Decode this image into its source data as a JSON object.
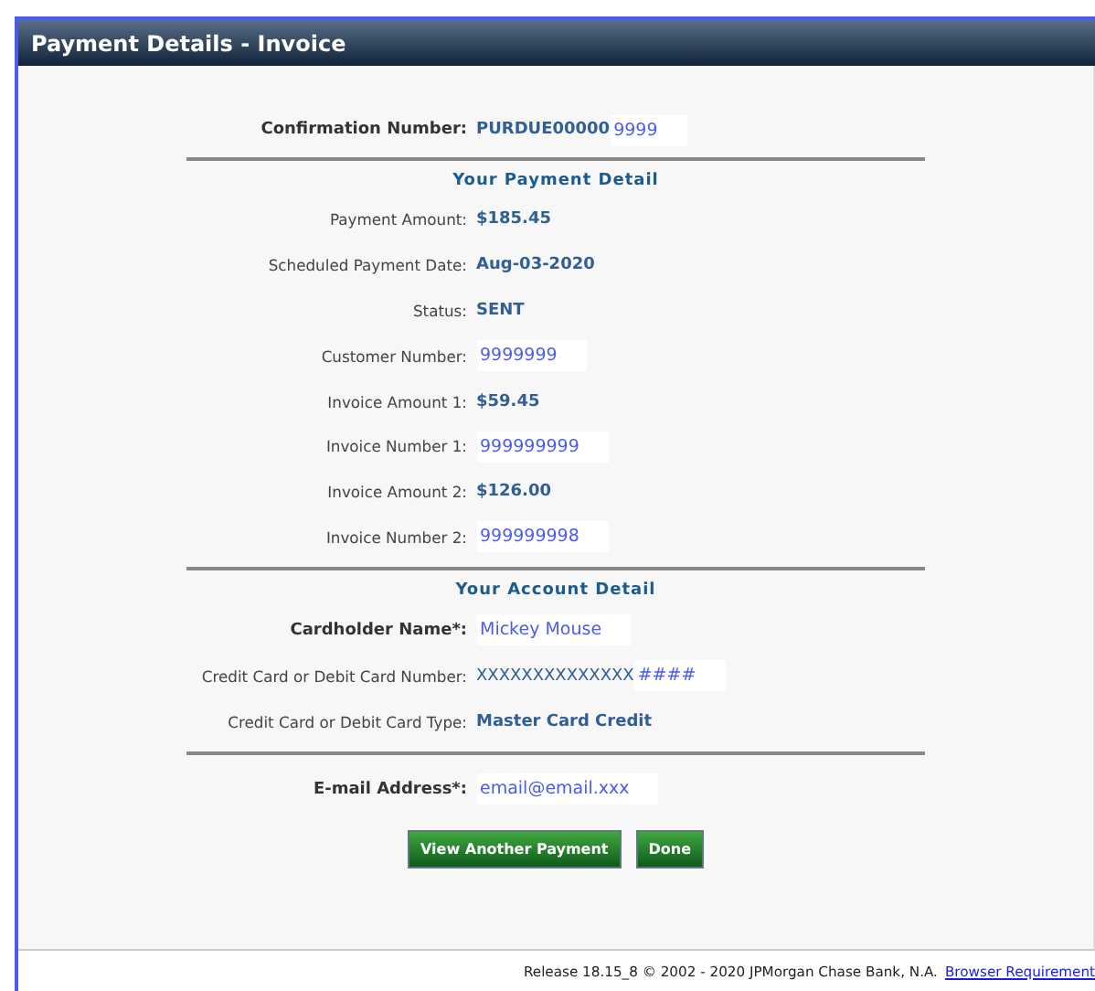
{
  "window": {
    "title": "Payment Details - Invoice"
  },
  "confirmation": {
    "label": "Confirmation Number:",
    "emphasis": true,
    "parts": [
      {
        "text": "PURDUE00000",
        "kind": "original"
      },
      {
        "text": "9999",
        "kind": "edited"
      }
    ]
  },
  "sections": [
    {
      "heading": "Your Payment Detail",
      "rows": [
        {
          "label": "Payment Amount:",
          "emphasis": false,
          "parts": [
            {
              "text": "$185.45",
              "kind": "original"
            }
          ]
        },
        {
          "label": "Scheduled Payment Date:",
          "emphasis": false,
          "parts": [
            {
              "text": "Aug-03-2020",
              "kind": "original"
            }
          ]
        },
        {
          "label": "Status:",
          "emphasis": false,
          "parts": [
            {
              "text": "SENT",
              "kind": "original"
            }
          ]
        },
        {
          "label": "Customer Number:",
          "emphasis": false,
          "parts": [
            {
              "text": "9999999",
              "kind": "edited"
            }
          ]
        },
        {
          "label": "Invoice Amount 1:",
          "emphasis": false,
          "parts": [
            {
              "text": "$59.45",
              "kind": "original"
            }
          ]
        },
        {
          "label": "Invoice Number 1:",
          "emphasis": false,
          "parts": [
            {
              "text": "999999999",
              "kind": "edited"
            }
          ]
        },
        {
          "label": "Invoice Amount 2:",
          "emphasis": false,
          "parts": [
            {
              "text": "$126.00",
              "kind": "original"
            }
          ]
        },
        {
          "label": "Invoice Number 2:",
          "emphasis": false,
          "parts": [
            {
              "text": "999999998",
              "kind": "edited"
            }
          ]
        }
      ]
    },
    {
      "heading": "Your Account Detail",
      "rows": [
        {
          "label": "Cardholder Name*:",
          "emphasis": true,
          "parts": [
            {
              "text": "Mickey Mouse",
              "kind": "edited"
            }
          ]
        },
        {
          "label": "Credit Card or Debit Card Number:",
          "emphasis": false,
          "parts": [
            {
              "text": "XXXXXXXXXXXXXX",
              "kind": "plain"
            },
            {
              "text": "####",
              "kind": "edited"
            }
          ]
        },
        {
          "label": "Credit Card or Debit Card Type:",
          "emphasis": false,
          "parts": [
            {
              "text": "Master Card Credit",
              "kind": "original"
            }
          ]
        }
      ]
    },
    {
      "rows": [
        {
          "label": "E-mail Address*:",
          "emphasis": true,
          "parts": [
            {
              "text": "email@email.xxx",
              "kind": "edited"
            }
          ]
        }
      ]
    }
  ],
  "buttons": [
    "View Another Payment",
    "Done"
  ],
  "footer": {
    "text": "Release 18.15_8 © 2002 - 2020 JPMorgan Chase Bank, N.A.",
    "link": "Browser Requirement"
  }
}
